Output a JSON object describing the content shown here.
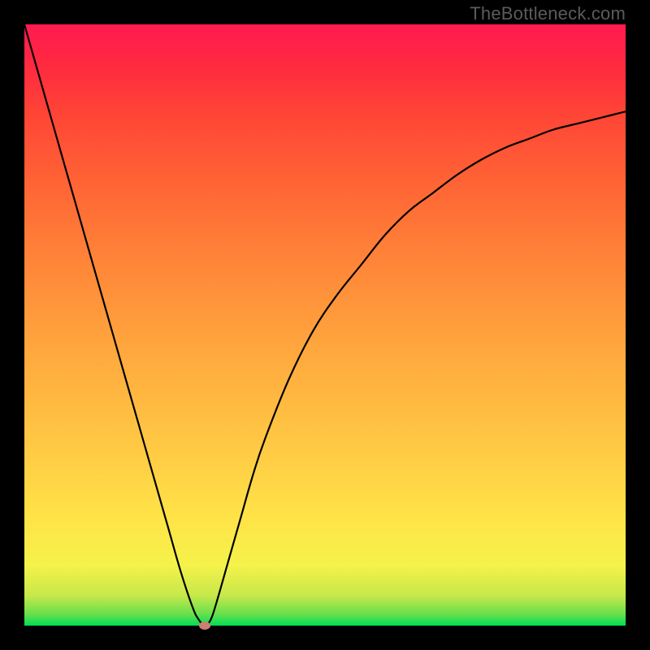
{
  "watermark": "TheBottleneck.com",
  "colors": {
    "frame": "#000000",
    "curve": "#000000",
    "dot": "#cc7e76",
    "gradient_top": "#ff1a50",
    "gradient_bottom": "#00dd55",
    "watermark": "#5b5b5b"
  },
  "chart_data": {
    "type": "line",
    "title": "",
    "xlabel": "",
    "ylabel": "",
    "xlim": [
      0,
      100
    ],
    "ylim": [
      0,
      100
    ],
    "x": [
      0,
      2,
      4,
      6,
      8,
      10,
      12,
      14,
      16,
      18,
      20,
      22,
      24,
      26,
      28,
      29,
      30,
      31,
      32,
      34,
      36,
      38,
      40,
      44,
      48,
      52,
      56,
      60,
      64,
      68,
      72,
      76,
      80,
      84,
      88,
      92,
      96,
      100
    ],
    "values": [
      100,
      93,
      86,
      79,
      72,
      65,
      58,
      51,
      44,
      37,
      30,
      23,
      16,
      9,
      3,
      1,
      0,
      1,
      4,
      11,
      18,
      25,
      31,
      41,
      49,
      55,
      60,
      65,
      69,
      72,
      75,
      77.5,
      79.5,
      81,
      82.5,
      83.5,
      84.5,
      85.5
    ],
    "minimum_point": {
      "x": 30,
      "y": 0
    },
    "background_map": "vertical rainbow gradient green→yellow→orange→red representing 0→100 on y-axis",
    "legend": null,
    "grid": false
  }
}
